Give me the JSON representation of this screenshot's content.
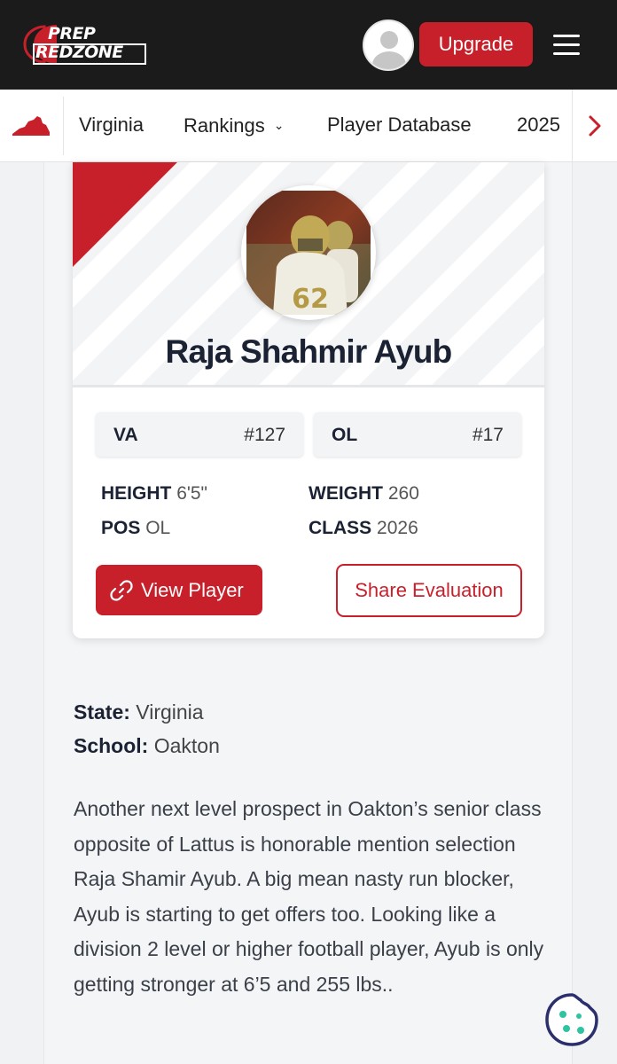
{
  "header": {
    "logo_line1": "PREP",
    "logo_line2": "REDZONE",
    "upgrade_label": "Upgrade"
  },
  "subnav": {
    "items": [
      {
        "label": "Virginia"
      },
      {
        "label": "Rankings"
      },
      {
        "label": "Player Database"
      },
      {
        "label": "2025"
      }
    ]
  },
  "player": {
    "name": "Raja Shahmir Ayub",
    "state_rank": {
      "label": "VA",
      "value": "#127"
    },
    "position_rank": {
      "label": "OL",
      "value": "#17"
    },
    "stats": [
      {
        "label": "HEIGHT",
        "value": "6'5\""
      },
      {
        "label": "WEIGHT",
        "value": "260"
      },
      {
        "label": "POS",
        "value": "OL"
      },
      {
        "label": "CLASS",
        "value": "2026"
      }
    ],
    "view_label": "View Player",
    "share_label": "Share Evaluation"
  },
  "details": {
    "state_label": "State:",
    "state_value": "Virginia",
    "school_label": "School:",
    "school_value": "Oakton",
    "evaluation": "Another next level prospect in Oakton’s senior class opposite of Lattus is honorable mention selection Raja Shamir Ayub. A big mean nasty run blocker, Ayub is starting to get offers too. Looking like a division 2 level or higher football player, Ayub is only getting stronger at 6’5 and 255 lbs.."
  },
  "colors": {
    "brand_red": "#c8202b",
    "header_bg": "#1b1b1b",
    "navy_text": "#1b2233"
  },
  "icons": [
    "prep-redzone-logo",
    "user-avatar-icon",
    "hamburger-menu-icon",
    "virginia-state-icon",
    "chevron-down-icon",
    "chevron-right-icon",
    "link-icon",
    "cookie-icon"
  ]
}
